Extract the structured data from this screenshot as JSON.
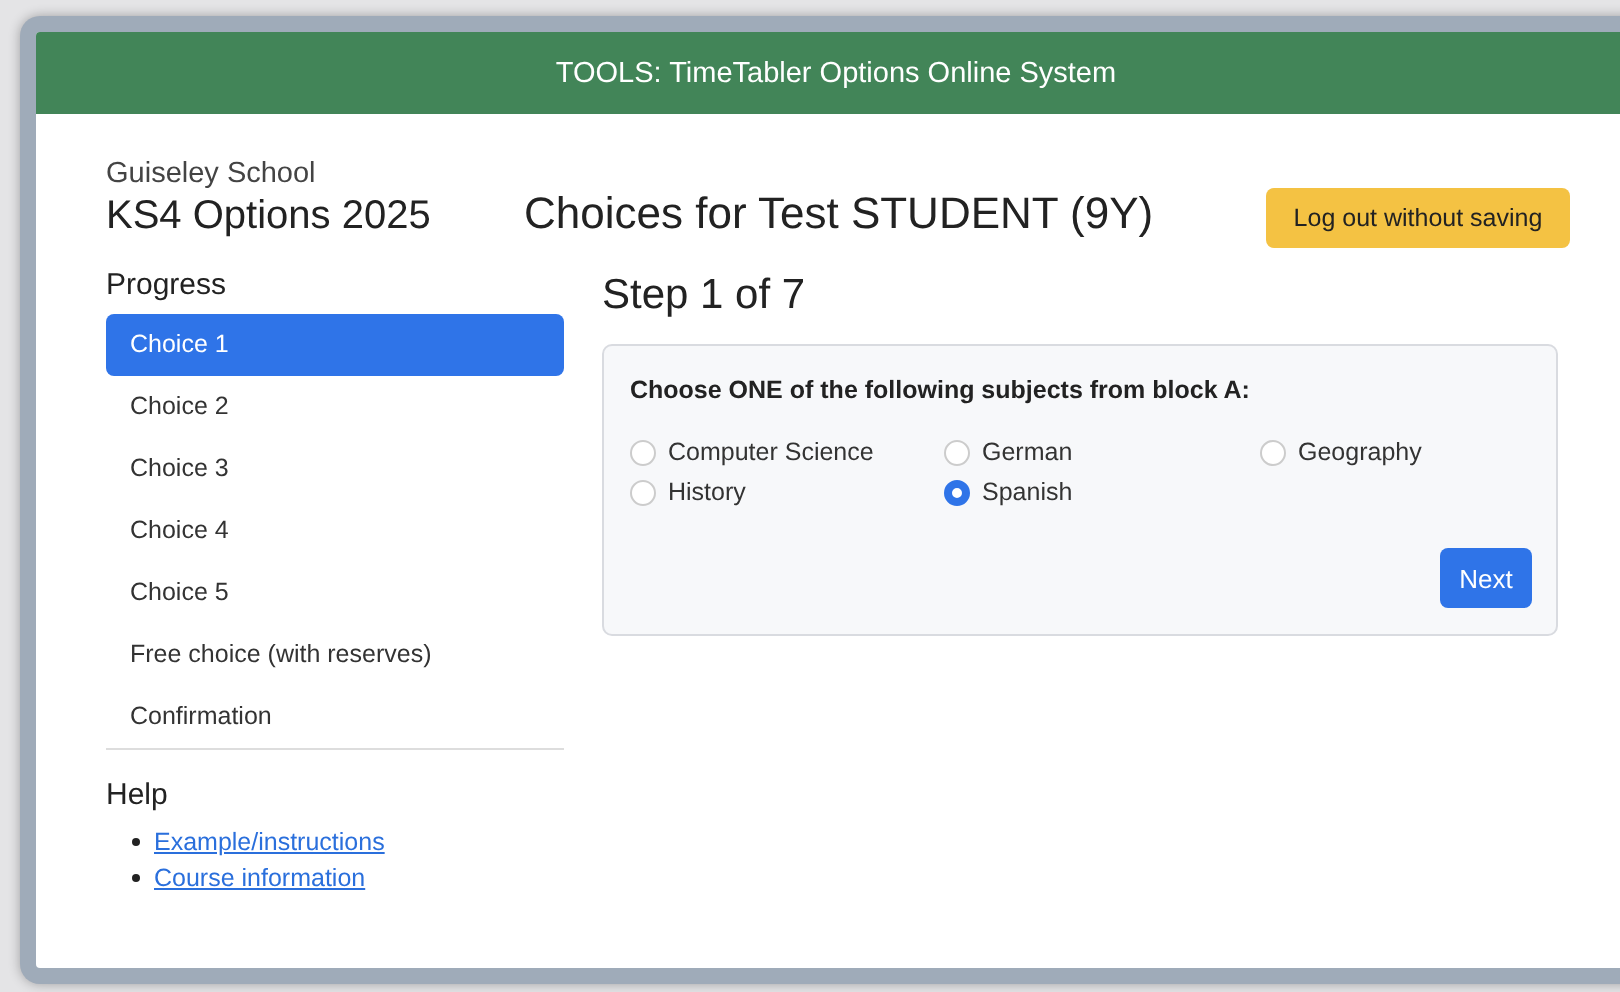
{
  "header": {
    "title": "TOOLS: TimeTabler Options Online System"
  },
  "school": {
    "name": "Guiseley School",
    "options_title": "KS4 Options 2025"
  },
  "page_title": "Choices for Test STUDENT (9Y)",
  "logout_button": "Log out without saving",
  "progress": {
    "heading": "Progress",
    "items": [
      {
        "label": "Choice 1",
        "selected": true
      },
      {
        "label": "Choice 2",
        "selected": false
      },
      {
        "label": "Choice 3",
        "selected": false
      },
      {
        "label": "Choice 4",
        "selected": false
      },
      {
        "label": "Choice 5",
        "selected": false
      },
      {
        "label": "Free choice (with reserves)",
        "selected": false
      },
      {
        "label": "Confirmation",
        "selected": false
      }
    ]
  },
  "help": {
    "heading": "Help",
    "links": [
      "Example/instructions",
      "Course information"
    ]
  },
  "step": "Step 1 of 7",
  "question": {
    "prompt": "Choose ONE of the following subjects from block A:",
    "options": [
      {
        "label": "Computer Science",
        "selected": false
      },
      {
        "label": "German",
        "selected": false
      },
      {
        "label": "Geography",
        "selected": false
      },
      {
        "label": "History",
        "selected": false
      },
      {
        "label": "Spanish",
        "selected": true
      }
    ]
  },
  "next_button": "Next"
}
